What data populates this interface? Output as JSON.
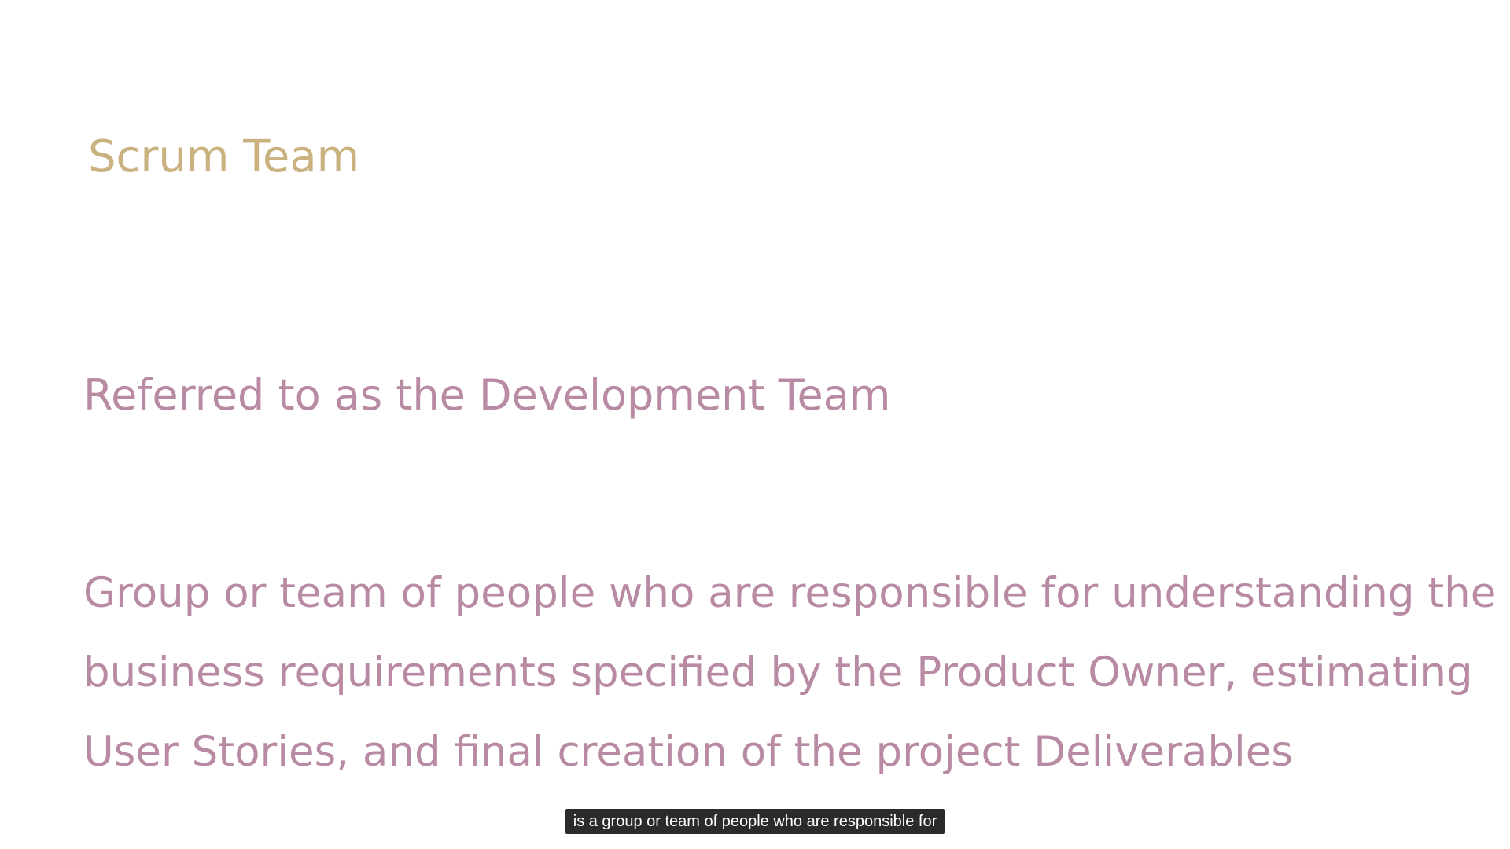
{
  "slide": {
    "title": "Scrum Team",
    "subtitle": "Referred to as the Development Team",
    "body_lines": [
      "Group or team of people who are responsible for understanding the",
      "business requirements specified by the Product Owner, estimating",
      "User Stories, and final creation of the project Deliverables"
    ]
  },
  "caption": {
    "text": "is a group or team of people who are responsible for"
  },
  "colors": {
    "background": "#ffffff",
    "title": "#c9b27f",
    "body": "#b98aa3",
    "caption_bg": "#2b2b2b",
    "caption_text": "#ffffff"
  }
}
